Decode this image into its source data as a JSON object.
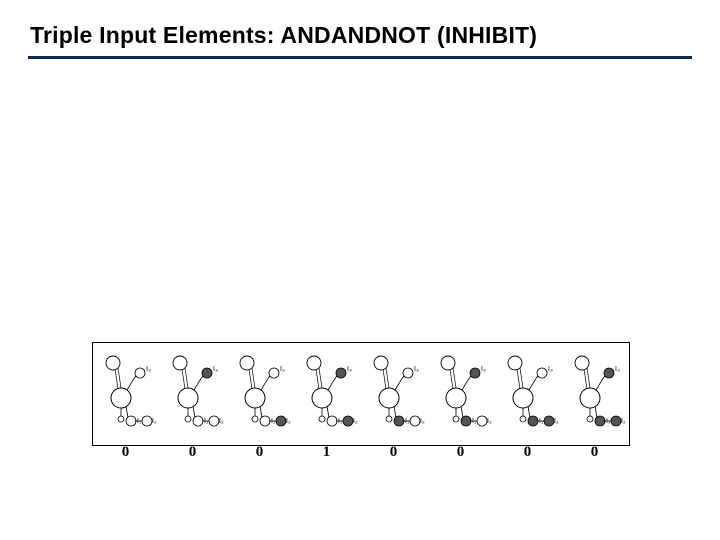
{
  "title": "Triple Input Elements:  ANDANDNOT (INHIBIT)",
  "gate": "ANDANDNOT",
  "alias": "INHIBIT",
  "inputs": {
    "i1": "I₁",
    "i2": "I₂",
    "i3": "I₃"
  },
  "truth": [
    {
      "i1": 0,
      "i2": 0,
      "i3": 0,
      "o": "0"
    },
    {
      "i1": 0,
      "i2": 0,
      "i3": 1,
      "o": "0"
    },
    {
      "i1": 0,
      "i2": 1,
      "i3": 0,
      "o": "0"
    },
    {
      "i1": 0,
      "i2": 1,
      "i3": 1,
      "o": "1"
    },
    {
      "i1": 1,
      "i2": 0,
      "i3": 0,
      "o": "0"
    },
    {
      "i1": 1,
      "i2": 0,
      "i3": 1,
      "o": "0"
    },
    {
      "i1": 1,
      "i2": 1,
      "i3": 0,
      "o": "0"
    },
    {
      "i1": 1,
      "i2": 1,
      "i3": 1,
      "o": "0"
    }
  ]
}
